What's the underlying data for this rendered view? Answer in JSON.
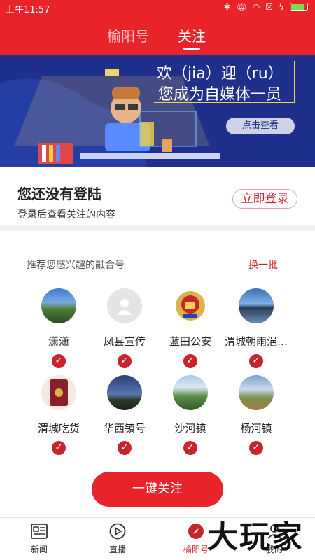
{
  "status": {
    "time": "上午11:57"
  },
  "header": {
    "tabs": [
      {
        "label": "榆阳号"
      },
      {
        "label": "关注"
      }
    ],
    "active_tab": 1
  },
  "banner": {
    "line1": "欢（jia）迎（ru）",
    "line2": "您成为自媒体一员",
    "button": "点击查看"
  },
  "login": {
    "title": "您还没有登陆",
    "subtitle": "登录后查看关注的内容",
    "button": "立即登录"
  },
  "recommend": {
    "title": "推荐您感兴趣的融合号",
    "refresh": "换一批",
    "accounts": [
      {
        "name": "潇潇",
        "checked": true
      },
      {
        "name": "凤县宣传",
        "checked": true
      },
      {
        "name": "蓝田公安",
        "checked": true
      },
      {
        "name": "渭城朝雨浥…",
        "checked": true
      },
      {
        "name": "渭城吃货",
        "checked": true
      },
      {
        "name": "华西镇号",
        "checked": true
      },
      {
        "name": "沙河镇",
        "checked": true
      },
      {
        "name": "杨河镇",
        "checked": true
      }
    ],
    "follow_all": "一键关注"
  },
  "nav": {
    "items": [
      {
        "label": "新闻",
        "icon": "news-icon"
      },
      {
        "label": "直播",
        "icon": "play-icon"
      },
      {
        "label": "榆阳号",
        "icon": "compass-icon"
      },
      {
        "label": "我的",
        "icon": "user-icon"
      }
    ],
    "active": 2
  },
  "watermark": "大玩家",
  "colors": {
    "brand_red": "#e8232a",
    "accent_red": "#c8242c",
    "banner_blue": "#1f2f8c"
  }
}
